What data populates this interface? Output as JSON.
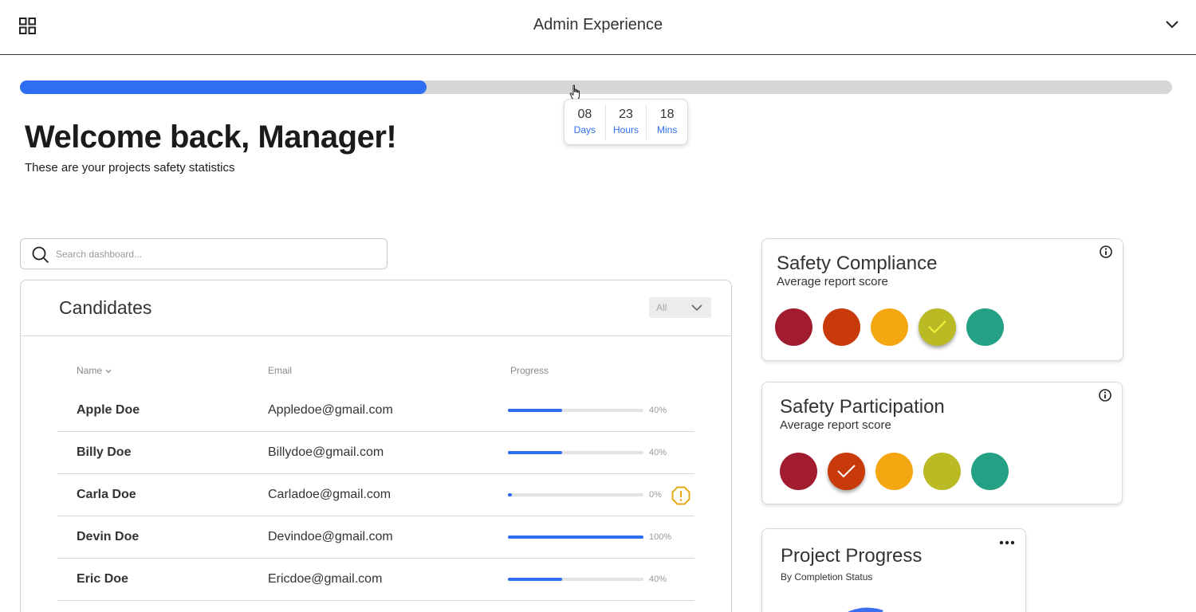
{
  "header": {
    "title": "Admin Experience"
  },
  "top_progress": {
    "percent": 35.3
  },
  "countdown": [
    {
      "value": "08",
      "unit": "Days"
    },
    {
      "value": "23",
      "unit": "Hours"
    },
    {
      "value": "18",
      "unit": "Mins"
    }
  ],
  "welcome": {
    "title": "Welcome back, Manager!",
    "subtitle": "These are your projects safety statistics"
  },
  "search": {
    "placeholder": "Search dashboard..."
  },
  "candidates": {
    "title": "Candidates",
    "filter_value": "All",
    "columns": {
      "name": "Name",
      "email": "Email",
      "progress": "Progress"
    },
    "rows": [
      {
        "name": "Apple Doe",
        "email": "Appledoe@gmail.com",
        "progress": 40,
        "progress_label": "40%",
        "warning": false
      },
      {
        "name": "Billy Doe",
        "email": "Billydoe@gmail.com",
        "progress": 40,
        "progress_label": "40%",
        "warning": false
      },
      {
        "name": "Carla Doe",
        "email": "Carladoe@gmail.com",
        "progress": 0,
        "progress_label": "0%",
        "warning": true
      },
      {
        "name": "Devin Doe",
        "email": "Devindoe@gmail.com",
        "progress": 100,
        "progress_label": "100%",
        "warning": false
      },
      {
        "name": "Eric Doe",
        "email": "Ericdoe@gmail.com",
        "progress": 40,
        "progress_label": "40%",
        "warning": false
      }
    ]
  },
  "safety_compliance": {
    "title": "Safety Compliance",
    "subtitle": "Average report score",
    "selected_index": 3,
    "colors": [
      "#a01c2e",
      "#c93a0a",
      "#f5a712",
      "#b9ba24",
      "#24a085"
    ],
    "check_color": "#f2f23a"
  },
  "safety_participation": {
    "title": "Safety Participation",
    "subtitle": "Average report score",
    "selected_index": 1,
    "colors": [
      "#a01c2e",
      "#c93a0a",
      "#f5a712",
      "#b9ba24",
      "#24a085"
    ],
    "check_color": "#ffffff"
  },
  "project_progress": {
    "title": "Project Progress",
    "subtitle": "By Completion Status"
  },
  "colors": {
    "accent": "#2f6ef0",
    "warning": "#e6a817"
  },
  "icons": {
    "header_left": "grid-icon",
    "header_right": "chevron-down-icon",
    "search": "search-icon",
    "info": "info-icon",
    "more": "more-icon",
    "warning": "warning-icon"
  }
}
